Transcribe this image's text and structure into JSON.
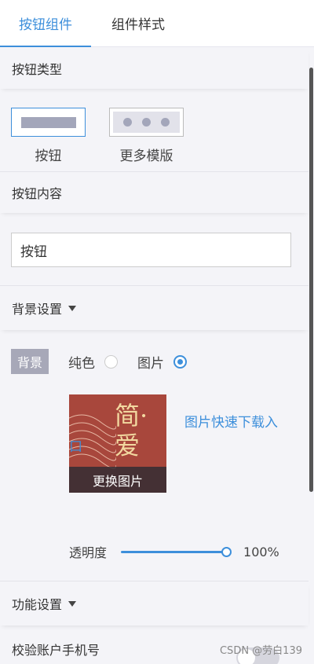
{
  "tabs": [
    {
      "label": "按钮组件",
      "active": true
    },
    {
      "label": "组件样式",
      "active": false
    }
  ],
  "button_type": {
    "title": "按钮类型",
    "options": [
      {
        "label": "按钮",
        "selected": true
      },
      {
        "label": "更多模版",
        "selected": false
      }
    ]
  },
  "button_content": {
    "title": "按钮内容",
    "value": "按钮"
  },
  "background": {
    "title": "背景设置",
    "tag": "背景",
    "options": [
      {
        "label": "纯色",
        "checked": false
      },
      {
        "label": "图片",
        "checked": true
      }
    ],
    "image": {
      "overlay_label": "更换图片",
      "book_title": "简·爱"
    },
    "download_link": "图片快速下载入口",
    "opacity": {
      "label": "透明度",
      "value": 100,
      "display": "100%"
    }
  },
  "function_settings": {
    "title": "功能设置"
  },
  "verify_phone": {
    "label": "校验账户手机号",
    "enabled": false
  },
  "watermark": "CSDN @劳白139",
  "colors": {
    "accent": "#3d8fdb",
    "tag_bg": "#a7a8b8",
    "book_cover": "#a8473c"
  }
}
